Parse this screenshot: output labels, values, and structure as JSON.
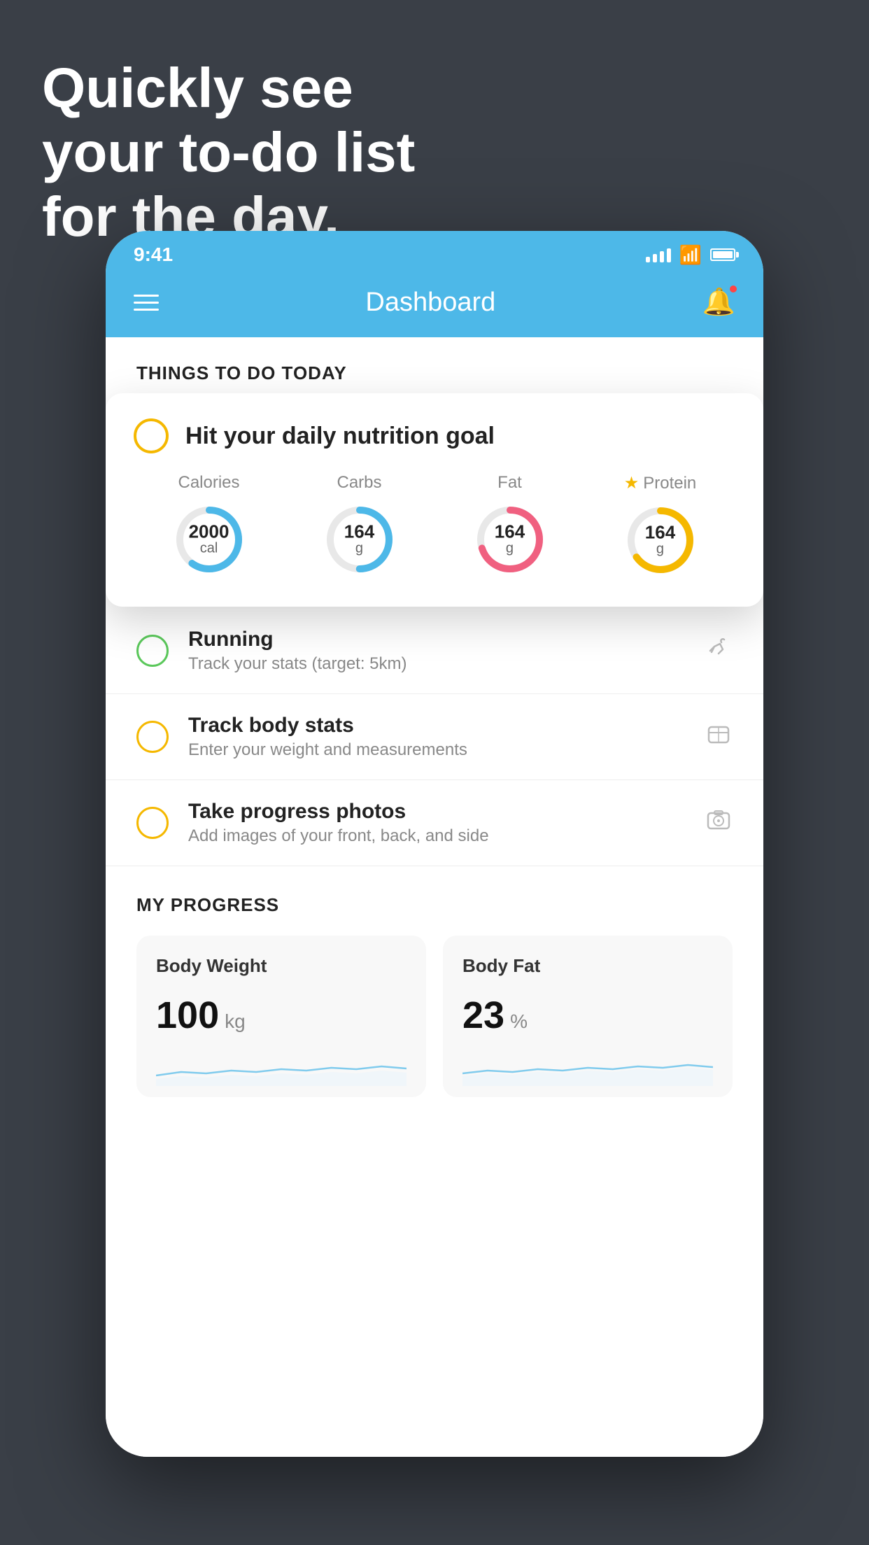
{
  "headline": {
    "line1": "Quickly see",
    "line2": "your to-do list",
    "line3": "for the day."
  },
  "statusBar": {
    "time": "9:41"
  },
  "navBar": {
    "title": "Dashboard"
  },
  "thingsToday": {
    "header": "THINGS TO DO TODAY"
  },
  "nutritionCard": {
    "title": "Hit your daily nutrition goal",
    "items": [
      {
        "label": "Calories",
        "value": "2000",
        "unit": "cal",
        "color": "#4db8e8",
        "progress": 0.6,
        "star": false
      },
      {
        "label": "Carbs",
        "value": "164",
        "unit": "g",
        "color": "#4db8e8",
        "progress": 0.5,
        "star": false
      },
      {
        "label": "Fat",
        "value": "164",
        "unit": "g",
        "color": "#f06080",
        "progress": 0.7,
        "star": false
      },
      {
        "label": "Protein",
        "value": "164",
        "unit": "g",
        "color": "#f5b800",
        "progress": 0.65,
        "star": true
      }
    ]
  },
  "todoItems": [
    {
      "id": "running",
      "name": "Running",
      "desc": "Track your stats (target: 5km)",
      "circleColor": "green",
      "icon": "👟"
    },
    {
      "id": "body-stats",
      "name": "Track body stats",
      "desc": "Enter your weight and measurements",
      "circleColor": "yellow",
      "icon": "⚖"
    },
    {
      "id": "progress-photos",
      "name": "Take progress photos",
      "desc": "Add images of your front, back, and side",
      "circleColor": "yellow",
      "icon": "🖼"
    }
  ],
  "myProgress": {
    "header": "MY PROGRESS",
    "cards": [
      {
        "title": "Body Weight",
        "value": "100",
        "unit": "kg"
      },
      {
        "title": "Body Fat",
        "value": "23",
        "unit": "%"
      }
    ]
  }
}
